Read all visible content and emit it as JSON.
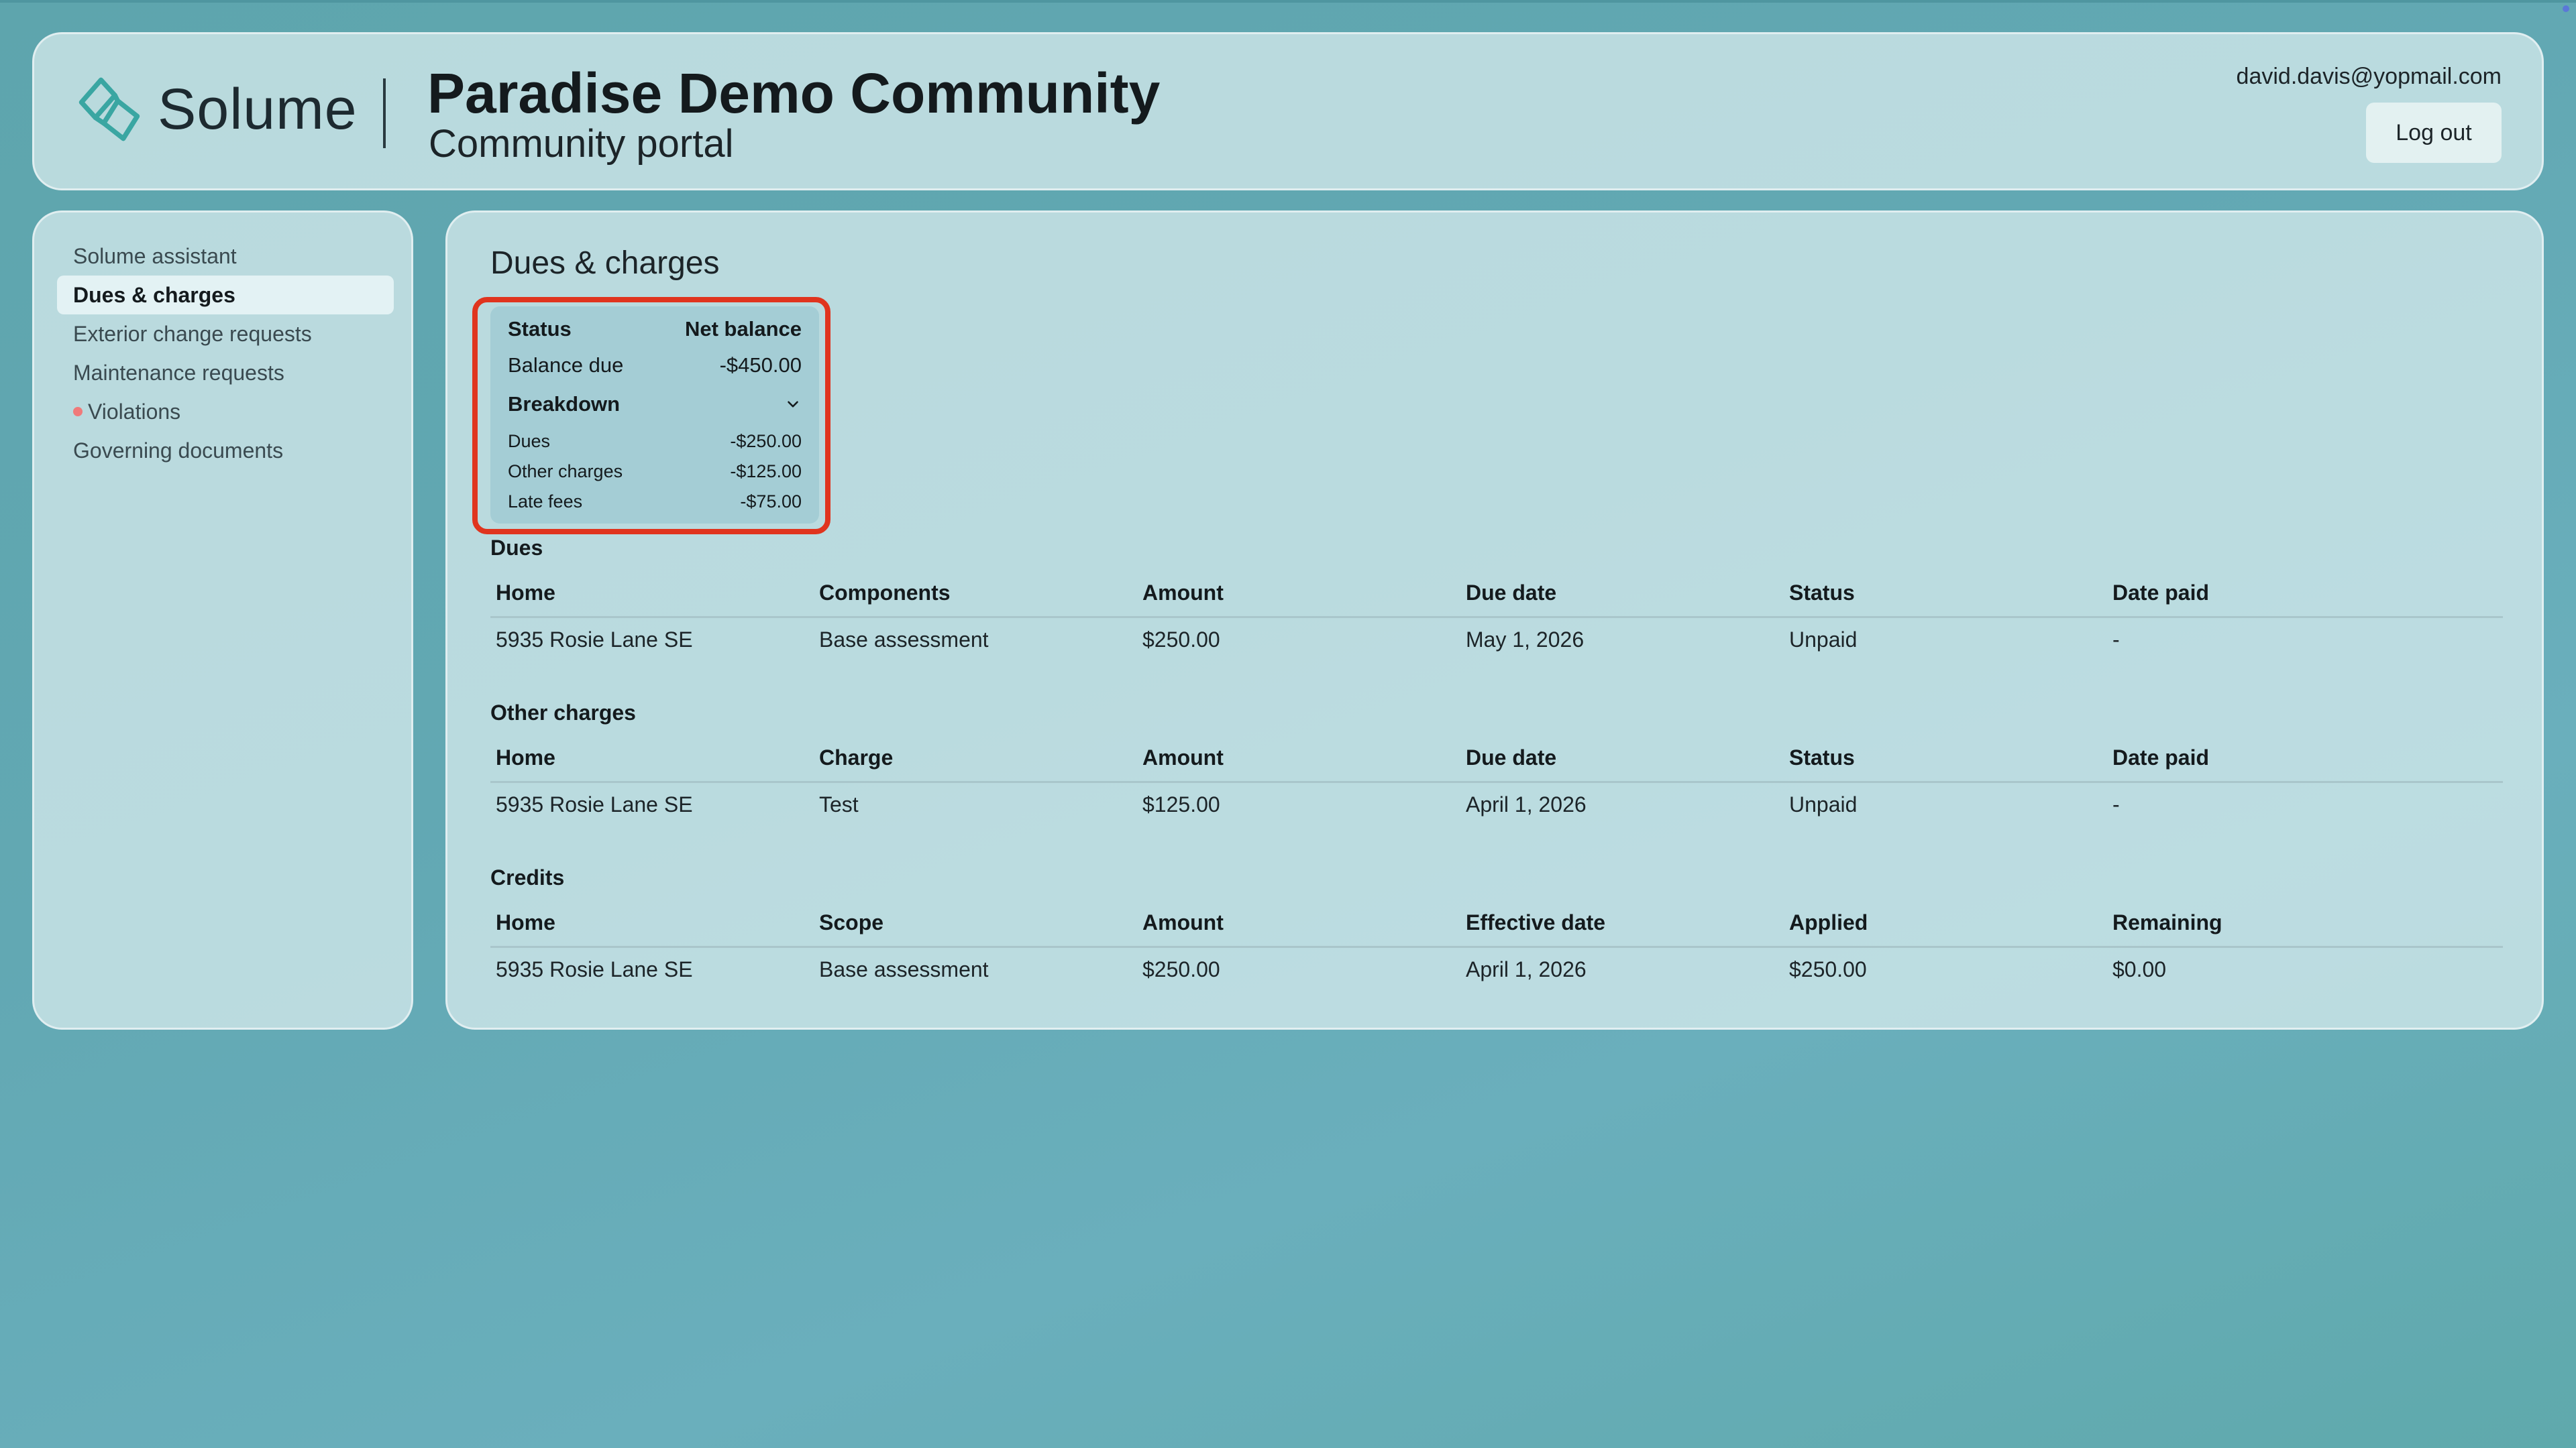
{
  "brand": {
    "name": "Solume",
    "accent": "#3aa6a2"
  },
  "header": {
    "community_name": "Paradise Demo Community",
    "portal_title": "Community portal",
    "user_email": "david.davis@yopmail.com",
    "logout_label": "Log out"
  },
  "sidebar": {
    "items": [
      {
        "label": "Solume assistant"
      },
      {
        "label": "Dues & charges"
      },
      {
        "label": "Exterior change requests"
      },
      {
        "label": "Maintenance requests"
      },
      {
        "label": "Violations"
      },
      {
        "label": "Governing documents"
      }
    ],
    "active_index": 1
  },
  "main": {
    "title": "Dues & charges",
    "summary": {
      "status_label": "Status",
      "status_value": "Net balance",
      "balance_label": "Balance due",
      "balance_value": "-$450.00",
      "breakdown_label": "Breakdown",
      "dues_label": "Dues",
      "dues_value": "-$250.00",
      "other_label": "Other charges",
      "other_value": "-$125.00",
      "late_label": "Late fees",
      "late_value": "-$75.00"
    },
    "dues": {
      "title": "Dues",
      "headers": [
        "Home",
        "Components",
        "Amount",
        "Due date",
        "Status",
        "Date paid"
      ],
      "rows": [
        [
          "5935 Rosie Lane SE",
          "Base assessment",
          "$250.00",
          "May 1, 2026",
          "Unpaid",
          "-"
        ]
      ]
    },
    "other_charges": {
      "title": "Other charges",
      "headers": [
        "Home",
        "Charge",
        "Amount",
        "Due date",
        "Status",
        "Date paid"
      ],
      "rows": [
        [
          "5935 Rosie Lane SE",
          "Test",
          "$125.00",
          "April 1, 2026",
          "Unpaid",
          "-"
        ]
      ]
    },
    "credits": {
      "title": "Credits",
      "headers": [
        "Home",
        "Scope",
        "Amount",
        "Effective date",
        "Applied",
        "Remaining"
      ],
      "rows": [
        [
          "5935 Rosie Lane SE",
          "Base assessment",
          "$250.00",
          "April 1, 2026",
          "$250.00",
          "$0.00"
        ]
      ]
    }
  }
}
